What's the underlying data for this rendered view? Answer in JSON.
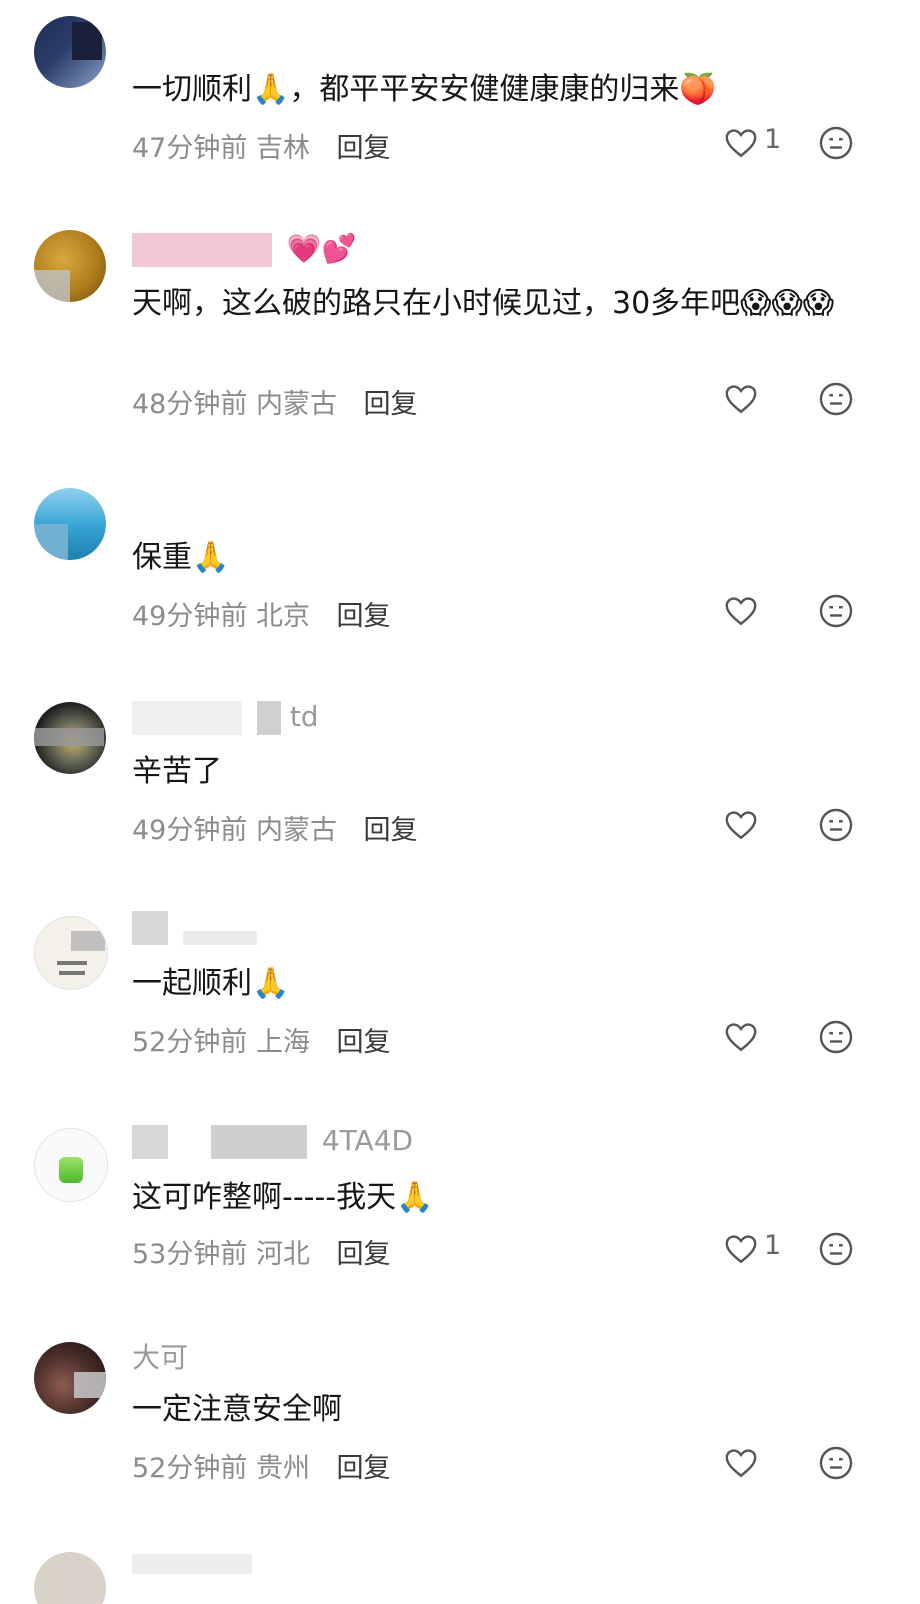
{
  "comments": [
    {
      "username": "",
      "text": "一切顺利🙏，都平平安安健健康康的归来🍑",
      "time": "47分钟前",
      "location": "吉林",
      "reply": "回复",
      "likes": "1"
    },
    {
      "username": "💗💕",
      "text": "天啊，这么破的路只在小时候见过，30多年吧😱😱😱",
      "time": "48分钟前",
      "location": "内蒙古",
      "reply": "回复",
      "likes": ""
    },
    {
      "username": "",
      "text": "保重🙏",
      "time": "49分钟前",
      "location": "北京",
      "reply": "回复",
      "likes": ""
    },
    {
      "username": "td",
      "text": "辛苦了",
      "time": "49分钟前",
      "location": "内蒙古",
      "reply": "回复",
      "likes": ""
    },
    {
      "username": "",
      "text": "一起顺利🙏",
      "time": "52分钟前",
      "location": "上海",
      "reply": "回复",
      "likes": ""
    },
    {
      "username": "4TA4D",
      "text": "这可咋整啊-----我天🙏",
      "time": "53分钟前",
      "location": "河北",
      "reply": "回复",
      "likes": "1"
    },
    {
      "username": "大可",
      "text": "一定注意安全啊",
      "time": "52分钟前",
      "location": "贵州",
      "reply": "回复",
      "likes": ""
    }
  ],
  "icons": {
    "like": "heart-outline-icon",
    "emoji": "neutral-face-icon"
  },
  "colors": {
    "meta": "#8c8c8c",
    "text": "#161616",
    "icon": "#555555"
  }
}
